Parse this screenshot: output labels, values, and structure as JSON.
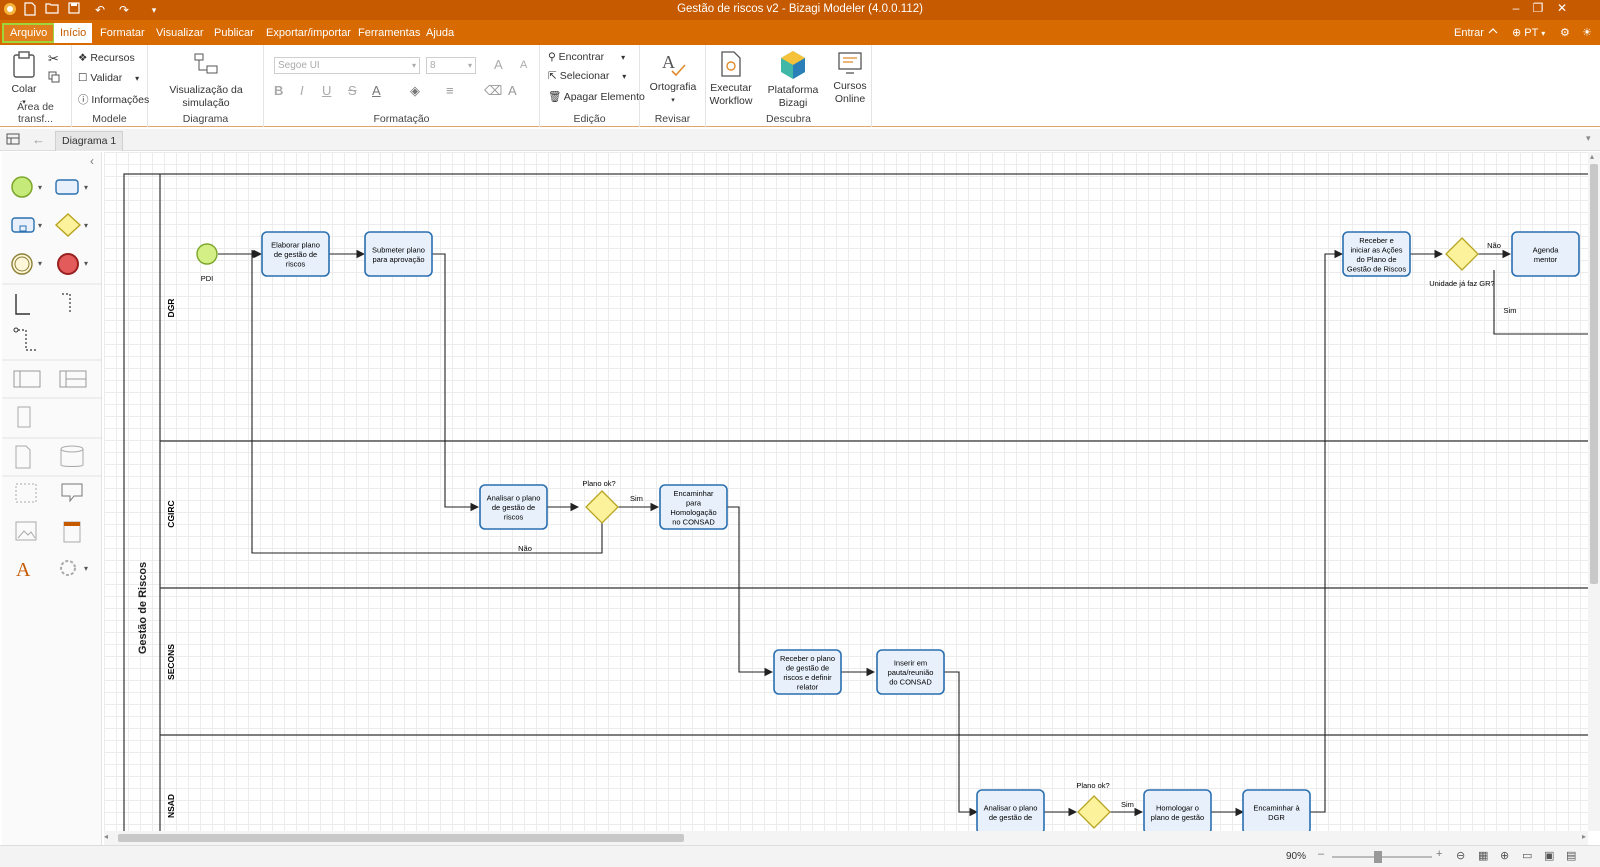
{
  "window": {
    "title": "Gestão de riscos v2 - Bizagi Modeler (4.0.0.112)"
  },
  "menu": {
    "file": "Arquivo",
    "home": "Início",
    "format": "Formatar",
    "view": "Visualizar",
    "publish": "Publicar",
    "export_import": "Exportar/importar",
    "tools": "Ferramentas",
    "help": "Ajuda",
    "login": "Entrar",
    "language": "PT"
  },
  "ribbon": {
    "clipboard": {
      "paste": "Colar",
      "label": "Área de transf..."
    },
    "model": {
      "resources": "Recursos",
      "validate": "Validar",
      "info": "Informações",
      "label": "Modele"
    },
    "diagram": {
      "sim_view": "Visualização da simulação",
      "label": "Diagrama"
    },
    "formatting": {
      "font": "Segoe UI",
      "size": "8",
      "label": "Formatação"
    },
    "editing": {
      "find": "Encontrar",
      "select": "Selecionar",
      "delete": "Apagar Elemento",
      "label": "Edição"
    },
    "review": {
      "spelling": "Ortografia",
      "label": "Revisar"
    },
    "discover": {
      "run_workflow_1": "Executar",
      "run_workflow_2": "Workflow",
      "platform": "Plataforma Bizagi",
      "courses_1": "Cursos",
      "courses_2": "Online",
      "label": "Descubra"
    }
  },
  "tabs": {
    "diagram1": "Diagrama 1"
  },
  "diagram": {
    "pool": "Gestão de Riscos",
    "lanes": [
      "DGR",
      "CGIRC",
      "SECONS",
      "NSAD"
    ],
    "start_label": "PDI",
    "tasks": {
      "t1": [
        "Elaborar plano",
        "de gestão de",
        "riscos"
      ],
      "t2": [
        "Submeter plano",
        "para aprovação"
      ],
      "t3": [
        "Analisar o plano",
        "de gestão de",
        "riscos"
      ],
      "t4": [
        "Encaminhar",
        "para",
        "Homologação",
        "no CONSAD"
      ],
      "t5": [
        "Receber o plano",
        "de gestão de",
        "riscos e definir",
        "relator"
      ],
      "t6": [
        "Inserir em",
        "pauta/reunião",
        "do CONSAD"
      ],
      "t7": [
        "Analisar o plano",
        "de gestão de"
      ],
      "t8": [
        "Homologar o",
        "plano de gestão"
      ],
      "t9": [
        "Encaminhar à",
        "DGR"
      ],
      "t10": [
        "Receber e",
        "iniciar as Ações",
        "do Plano de",
        "Gestão de Riscos"
      ],
      "t11": [
        "Agenda",
        "mentor"
      ]
    },
    "gateways": {
      "g1": "Plano ok?",
      "g2": "Plano ok?",
      "g3": "Unidade já faz GR?"
    },
    "flows": {
      "yes": "Sim",
      "no": "Não"
    }
  },
  "status": {
    "zoom": "90%"
  }
}
